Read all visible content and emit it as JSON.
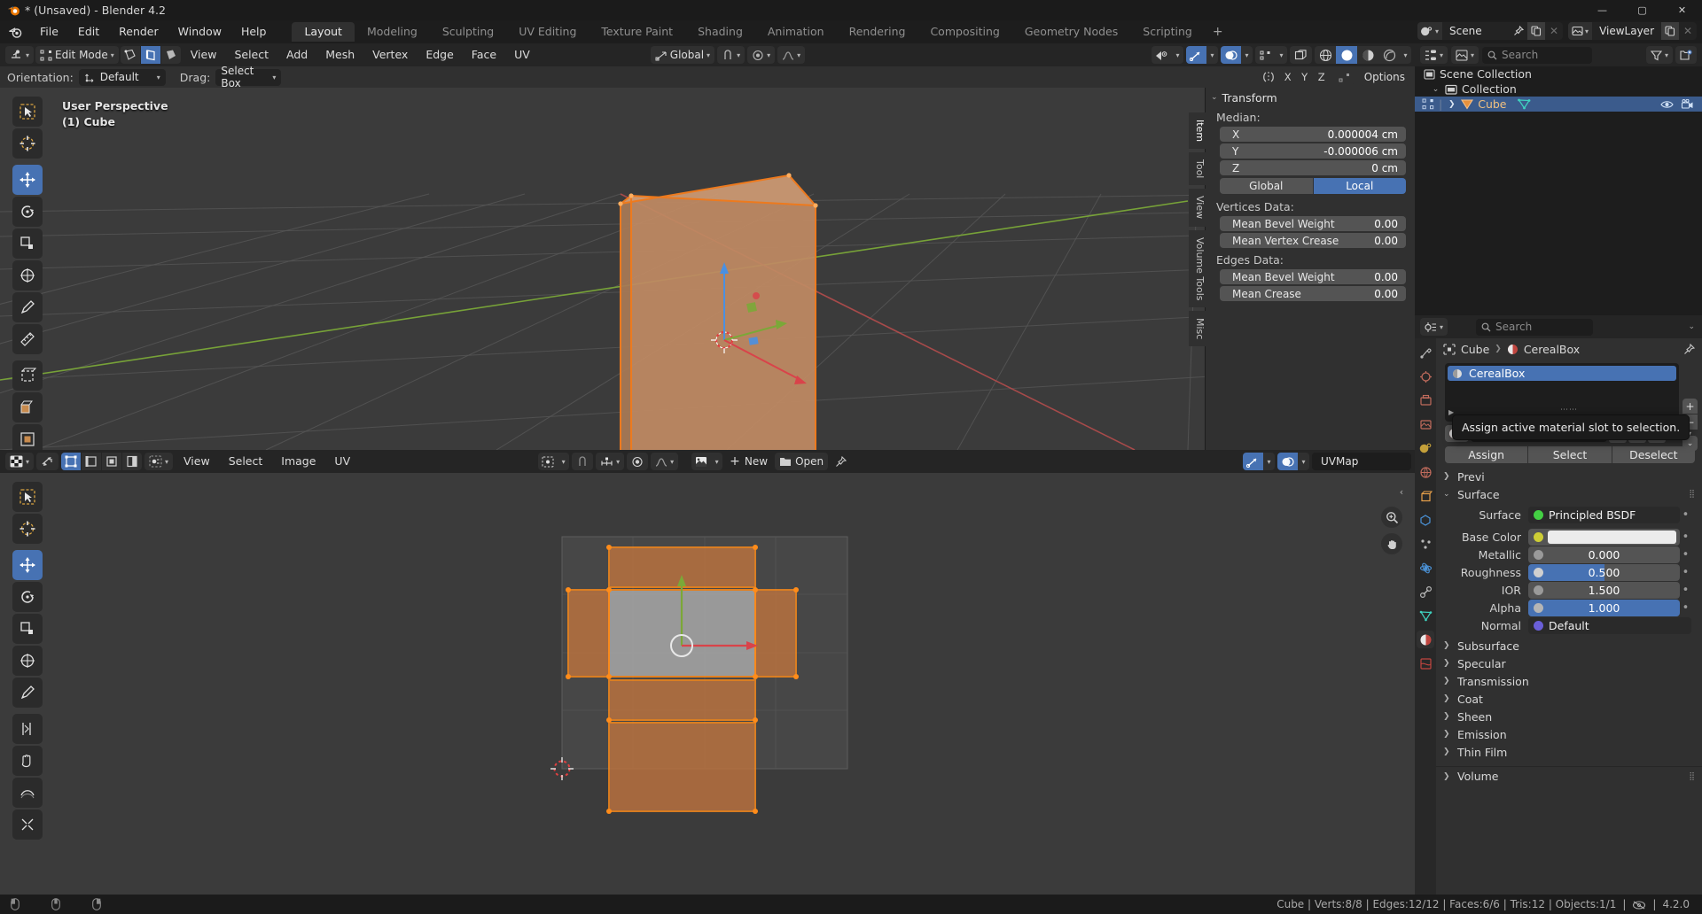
{
  "window": {
    "title": "* (Unsaved) - Blender 4.2",
    "minimize": "—",
    "maximize": "▢",
    "close": "✕"
  },
  "topbar": {
    "menus": [
      "File",
      "Edit",
      "Render",
      "Window",
      "Help"
    ],
    "workspaces": [
      {
        "label": "Layout",
        "active": true
      },
      {
        "label": "Modeling",
        "active": false
      },
      {
        "label": "Sculpting",
        "active": false
      },
      {
        "label": "UV Editing",
        "active": false
      },
      {
        "label": "Texture Paint",
        "active": false
      },
      {
        "label": "Shading",
        "active": false
      },
      {
        "label": "Animation",
        "active": false
      },
      {
        "label": "Rendering",
        "active": false
      },
      {
        "label": "Compositing",
        "active": false
      },
      {
        "label": "Geometry Nodes",
        "active": false
      },
      {
        "label": "Scripting",
        "active": false
      }
    ],
    "add_workspace": "+",
    "scene_name": "Scene",
    "viewlayer_name": "ViewLayer"
  },
  "viewport_header": {
    "mode": "Edit Mode",
    "menus": [
      "View",
      "Select",
      "Add",
      "Mesh",
      "Vertex",
      "Edge",
      "Face",
      "UV"
    ],
    "transform_orientation": "Global",
    "select_modes": [
      "vertex-select",
      "edge-select",
      "face-select"
    ],
    "active_select_mode": "edge-select"
  },
  "tool_settings": {
    "orientation_label": "Orientation:",
    "orientation_value": "Default",
    "drag_label": "Drag:",
    "drag_value": "Select Box",
    "axis_buttons": [
      "X",
      "Y",
      "Z"
    ],
    "options_label": "Options"
  },
  "viewport": {
    "overlay_line1": "User Perspective",
    "overlay_line2": "(1) Cube",
    "gizmo_axes": [
      "X",
      "Y",
      "Z"
    ],
    "accent_orange": "#ED9E5C",
    "mesh_face_color": "#C08A63",
    "mesh_edge_color": "#ED7A1E"
  },
  "npanel": {
    "tabs": [
      "Item",
      "Tool",
      "View",
      "Volume Tools",
      "Misc"
    ],
    "active_tab": "Item",
    "panel_title": "Transform",
    "median_label": "Median:",
    "median": [
      {
        "axis": "X",
        "value": "0.000004 cm"
      },
      {
        "axis": "Y",
        "value": "-0.000006 cm"
      },
      {
        "axis": "Z",
        "value": "0 cm"
      }
    ],
    "space_buttons": [
      {
        "label": "Global",
        "active": false
      },
      {
        "label": "Local",
        "active": true
      }
    ],
    "vertices_label": "Vertices Data:",
    "vertices_rows": [
      {
        "label": "Mean Bevel Weight",
        "value": "0.00"
      },
      {
        "label": "Mean Vertex Crease",
        "value": "0.00"
      }
    ],
    "edges_label": "Edges Data:",
    "edges_rows": [
      {
        "label": "Mean Bevel Weight",
        "value": "0.00"
      },
      {
        "label": "Mean Crease",
        "value": "0.00"
      }
    ]
  },
  "uv_editor": {
    "menus": [
      "View",
      "Select",
      "Image",
      "UV"
    ],
    "new_label": "New",
    "open_label": "Open",
    "uvmap_name": "UVMap"
  },
  "outliner": {
    "search_placeholder": "Search",
    "rows": [
      {
        "label": "Scene Collection",
        "indent": 0,
        "selected": false,
        "icon": "scene-collection-icon",
        "has_chevron": false
      },
      {
        "label": "Collection",
        "indent": 1,
        "selected": false,
        "icon": "collection-icon",
        "has_chevron": true
      },
      {
        "label": "Cube",
        "indent": 2,
        "selected": true,
        "icon": "mesh-object-icon",
        "has_chevron": true
      }
    ]
  },
  "properties": {
    "search_placeholder": "Search",
    "breadcrumb": [
      "Cube",
      "CerealBox"
    ],
    "material_slots": [
      {
        "name": "CerealBox",
        "selected": true
      }
    ],
    "material_name": "CerealBox",
    "slot_buttons": {
      "add": "+",
      "remove": "−",
      "menu": "⌄"
    },
    "assign_row": [
      "Assign",
      "Select",
      "Deselect"
    ],
    "tooltip": "Assign active material slot to selection.",
    "preview_section": "Previ",
    "surface_section": "Surface",
    "surface_rows": [
      {
        "label": "Surface",
        "value": "Principled BSDF",
        "type": "enum",
        "sock": "#43cf43"
      },
      {
        "label": "Base Color",
        "value": "",
        "type": "color",
        "sock": "#cdcd35",
        "color": "#ececec"
      },
      {
        "label": "Metallic",
        "value": "0.000",
        "type": "slider",
        "sock": "#9a9a9a",
        "fill": 0
      },
      {
        "label": "Roughness",
        "value": "0.500",
        "type": "slider",
        "sock": "#cfcfcf",
        "fill": 50
      },
      {
        "label": "IOR",
        "value": "1.500",
        "type": "slider",
        "sock": "#9a9a9a",
        "fill": 0
      },
      {
        "label": "Alpha",
        "value": "1.000",
        "type": "slider",
        "sock": "#b5b5b5",
        "fill": 100
      },
      {
        "label": "Normal",
        "value": "Default",
        "type": "enum",
        "sock": "#6a5fd8"
      }
    ],
    "collapsed_sections": [
      "Subsurface",
      "Specular",
      "Transmission",
      "Coat",
      "Sheen",
      "Emission",
      "Thin Film"
    ],
    "volume_section": "Volume"
  },
  "statusbar": {
    "stats": "Cube | Verts:8/8 | Edges:12/12 | Faces:6/6 | Tris:12 | Objects:1/1",
    "version": "4.2.0"
  }
}
